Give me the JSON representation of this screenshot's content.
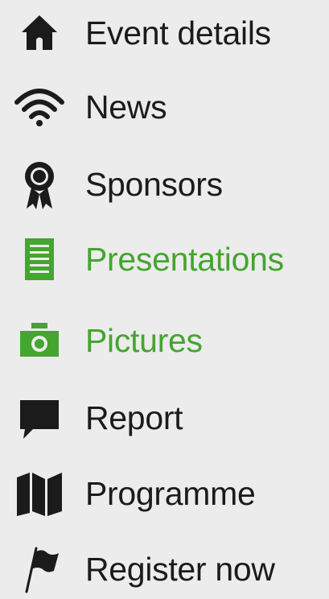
{
  "nav": {
    "items": [
      {
        "label": "Event details",
        "icon": "home-icon",
        "active": false
      },
      {
        "label": "News",
        "icon": "wifi-icon",
        "active": false
      },
      {
        "label": "Sponsors",
        "icon": "award-ribbon-icon",
        "active": false
      },
      {
        "label": "Presentations",
        "icon": "document-icon",
        "active": true
      },
      {
        "label": "Pictures",
        "icon": "camera-icon",
        "active": true
      },
      {
        "label": "Report",
        "icon": "speech-bubble-icon",
        "active": false
      },
      {
        "label": "Programme",
        "icon": "map-icon",
        "active": false
      },
      {
        "label": "Register now",
        "icon": "flag-icon",
        "active": false
      }
    ]
  },
  "colors": {
    "background": "#ececec",
    "text": "#1b1b1b",
    "active": "#44a52f"
  }
}
